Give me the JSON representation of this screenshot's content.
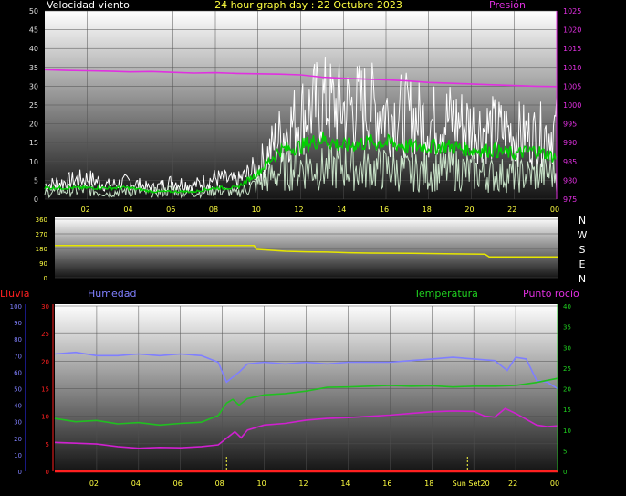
{
  "title": "24 hour graph day : 22 Octubre 2023",
  "chart_data": [
    {
      "id": "wind",
      "type": "line",
      "title": "24 hour graph day : 22 Octubre 2023",
      "left_axis_label": "Velocidad viento",
      "right_axis_label": "Presión",
      "ylim_left": [
        0,
        50
      ],
      "yticks_left": [
        "0",
        "5",
        "10",
        "15",
        "20",
        "25",
        "30",
        "35",
        "40",
        "45",
        "50"
      ],
      "ylim_right": [
        975,
        1025
      ],
      "yticks_right": [
        "975",
        "980",
        "985",
        "990",
        "995",
        "1000",
        "1005",
        "1010",
        "1015",
        "1020",
        "1025"
      ],
      "x_hours": [
        0,
        1,
        2,
        3,
        4,
        5,
        6,
        7,
        8,
        9,
        10,
        11,
        12,
        13,
        14,
        15,
        16,
        17,
        18,
        19,
        20,
        21,
        22,
        23,
        24
      ],
      "xticks": [
        "02",
        "04",
        "06",
        "08",
        "10",
        "12",
        "14",
        "16",
        "18",
        "20",
        "22",
        "00"
      ],
      "series": [
        {
          "role": "gust",
          "color": "#ffffff",
          "values": [
            4,
            5,
            6,
            4,
            5,
            3,
            5,
            4,
            6,
            5,
            9,
            18,
            24,
            28,
            26,
            27,
            25,
            24,
            22,
            23,
            21,
            20,
            19,
            18,
            20
          ]
        },
        {
          "role": "speed",
          "color": "#e0ffe0",
          "values": [
            2,
            3,
            3,
            2,
            3,
            2,
            3,
            2,
            3,
            2,
            5,
            9,
            11,
            10,
            11,
            10,
            10,
            9,
            9,
            10,
            9,
            8,
            8,
            8,
            9
          ]
        },
        {
          "role": "average",
          "color": "#00d000",
          "values": [
            3,
            3,
            3,
            3,
            3,
            2,
            2,
            2,
            3,
            3,
            7,
            13,
            14,
            16,
            14,
            15,
            15,
            14,
            14,
            14,
            13,
            13,
            12,
            13,
            11
          ]
        },
        {
          "role": "pressure",
          "color": "#e030e0",
          "values": [
            1009.4,
            1009.2,
            1009.1,
            1009.0,
            1008.8,
            1008.9,
            1008.7,
            1008.5,
            1008.6,
            1008.4,
            1008.3,
            1008.2,
            1008.0,
            1007.4,
            1007.1,
            1006.9,
            1006.7,
            1006.4,
            1006.0,
            1005.8,
            1005.6,
            1005.4,
            1005.2,
            1005.0,
            1004.9
          ]
        }
      ]
    },
    {
      "id": "direction",
      "type": "line",
      "ylim": [
        0,
        360
      ],
      "yticks": [
        "0",
        "90",
        "180",
        "270",
        "360"
      ],
      "compass_labels": [
        "N",
        "W",
        "S",
        "E",
        "N"
      ],
      "series": [
        {
          "role": "direction",
          "color": "#e6e600",
          "points": [
            [
              0,
              198
            ],
            [
              9.5,
              198
            ],
            [
              9.6,
              175
            ],
            [
              11,
              163
            ],
            [
              12,
              160
            ],
            [
              13,
              158
            ],
            [
              14,
              154
            ],
            [
              15,
              152
            ],
            [
              17,
              150
            ],
            [
              19,
              147
            ],
            [
              20.5,
              145
            ],
            [
              20.7,
              128
            ],
            [
              24,
              128
            ]
          ]
        }
      ]
    },
    {
      "id": "temp",
      "type": "line",
      "left_axis_label": "Lluvia",
      "left2_axis_label": "Humedad",
      "right_label_1": "Temperatura",
      "right_label_2": "Punto rocío",
      "ylim_rain": [
        0,
        30
      ],
      "yticks_rain": [
        "0",
        "5",
        "10",
        "15",
        "20",
        "25",
        "30"
      ],
      "ylim_hum": [
        0,
        100
      ],
      "yticks_hum": [
        "0",
        "10",
        "20",
        "30",
        "40",
        "50",
        "60",
        "70",
        "80",
        "90",
        "100"
      ],
      "ylim_temp": [
        0,
        40
      ],
      "yticks_temp": [
        "0",
        "5",
        "10",
        "15",
        "20",
        "25",
        "30",
        "35",
        "40"
      ],
      "xticks": [
        "02",
        "04",
        "06",
        "08",
        "10",
        "12",
        "14",
        "16",
        "18",
        "Sun Set20",
        "22",
        "00"
      ],
      "markers_hours": [
        8.2,
        19.7
      ],
      "series": [
        {
          "role": "humidity",
          "color": "#7f7fff",
          "points": [
            [
              0,
              71
            ],
            [
              1,
              72
            ],
            [
              2,
              70
            ],
            [
              3,
              70
            ],
            [
              4,
              71
            ],
            [
              5,
              70
            ],
            [
              6,
              71
            ],
            [
              7,
              70
            ],
            [
              7.8,
              66
            ],
            [
              8.2,
              54
            ],
            [
              8.8,
              60
            ],
            [
              9.2,
              65
            ],
            [
              10,
              66
            ],
            [
              11,
              65
            ],
            [
              12,
              66
            ],
            [
              13,
              65
            ],
            [
              14,
              66
            ],
            [
              15,
              66
            ],
            [
              16,
              66
            ],
            [
              17,
              67
            ],
            [
              18,
              68
            ],
            [
              19,
              69
            ],
            [
              20,
              68
            ],
            [
              21,
              67
            ],
            [
              21.6,
              61
            ],
            [
              22.0,
              69
            ],
            [
              22.5,
              68
            ],
            [
              23.0,
              55
            ],
            [
              23.5,
              54
            ],
            [
              24,
              50
            ]
          ]
        },
        {
          "role": "temperature",
          "color": "#20c020",
          "points": [
            [
              0,
              12.8
            ],
            [
              1,
              12.0
            ],
            [
              2,
              12.3
            ],
            [
              3,
              11.5
            ],
            [
              4,
              11.8
            ],
            [
              5,
              11.2
            ],
            [
              6,
              11.6
            ],
            [
              7,
              11.9
            ],
            [
              7.8,
              13.5
            ],
            [
              8.2,
              16.5
            ],
            [
              8.5,
              17.4
            ],
            [
              8.8,
              16.0
            ],
            [
              9.2,
              17.6
            ],
            [
              10,
              18.5
            ],
            [
              11,
              18.8
            ],
            [
              12,
              19.4
            ],
            [
              13,
              20.3
            ],
            [
              14,
              20.4
            ],
            [
              15,
              20.6
            ],
            [
              16,
              20.8
            ],
            [
              17,
              20.6
            ],
            [
              18,
              20.7
            ],
            [
              19,
              20.4
            ],
            [
              20,
              20.6
            ],
            [
              21,
              20.6
            ],
            [
              22,
              20.8
            ],
            [
              23,
              21.5
            ],
            [
              24,
              22.5
            ]
          ]
        },
        {
          "role": "dewpoint",
          "color": "#d020d0",
          "points": [
            [
              0,
              7.0
            ],
            [
              1,
              6.8
            ],
            [
              2,
              6.6
            ],
            [
              3,
              6.0
            ],
            [
              4,
              5.6
            ],
            [
              5,
              5.8
            ],
            [
              6,
              5.7
            ],
            [
              7,
              6.0
            ],
            [
              7.8,
              6.4
            ],
            [
              8.2,
              8.0
            ],
            [
              8.6,
              9.6
            ],
            [
              8.9,
              8.1
            ],
            [
              9.2,
              10.0
            ],
            [
              10,
              11.2
            ],
            [
              11,
              11.6
            ],
            [
              12,
              12.4
            ],
            [
              13,
              12.8
            ],
            [
              14,
              13.0
            ],
            [
              15,
              13.3
            ],
            [
              16,
              13.6
            ],
            [
              17,
              14.0
            ],
            [
              18,
              14.4
            ],
            [
              19,
              14.6
            ],
            [
              20,
              14.5
            ],
            [
              20.5,
              13.4
            ],
            [
              21,
              13.1
            ],
            [
              21.5,
              15.2
            ],
            [
              22,
              14.0
            ],
            [
              23,
              11.2
            ],
            [
              23.5,
              10.8
            ],
            [
              24,
              11.0
            ]
          ]
        },
        {
          "role": "rain",
          "color": "#ff2020",
          "points": [
            [
              0,
              0
            ],
            [
              24,
              0
            ]
          ]
        }
      ]
    }
  ]
}
